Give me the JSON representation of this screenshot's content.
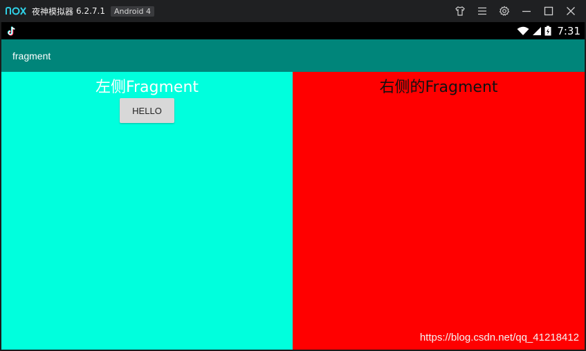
{
  "emulator": {
    "app_name": "夜神模拟器",
    "version": "6.2.7.1",
    "android_badge": "Android 4",
    "icons": [
      "nox-logo",
      "skin-icon",
      "menu-icon",
      "settings-icon",
      "minimize-icon",
      "maximize-icon",
      "close-icon"
    ]
  },
  "statusbar": {
    "time": "7:31",
    "icons": [
      "tiktok-icon",
      "wifi-icon",
      "signal-icon",
      "battery-icon"
    ]
  },
  "actionbar": {
    "title": "fragment"
  },
  "left_fragment": {
    "title": "左侧Fragment",
    "button_label": "HELLO"
  },
  "right_fragment": {
    "title": "右侧的Fragment"
  },
  "watermark": "https://blog.csdn.net/qq_41218412",
  "colors": {
    "actionbar": "#00857a",
    "left_pane": "#00ffdd",
    "right_pane": "#ff0000",
    "titlebar": "#1f2022",
    "nox_logo": "#2fd0e6"
  }
}
